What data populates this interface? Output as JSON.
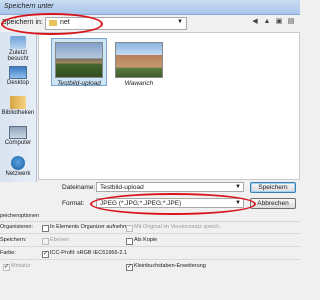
{
  "window": {
    "title": "Speichern unter"
  },
  "toolbar": {
    "lookin_label": "Speichern in:",
    "lookin_value": "net"
  },
  "places": [
    {
      "label": "Zuletzt besucht",
      "icon": "recent-places-icon"
    },
    {
      "label": "Desktop",
      "icon": "desktop-icon"
    },
    {
      "label": "Bibliotheken",
      "icon": "libraries-icon"
    },
    {
      "label": "Computer",
      "icon": "computer-icon"
    },
    {
      "label": "Netzwerk",
      "icon": "network-icon"
    }
  ],
  "files": [
    {
      "name": "Testbild-upload",
      "selected": true
    },
    {
      "name": "Wawarich",
      "selected": false
    }
  ],
  "form": {
    "filename_label": "Dateiname:",
    "filename_value": "Testbild-upload",
    "format_label": "Format:",
    "format_value": "JPEG (*.JPG;*.JPEG;*.JPE)",
    "save_label": "Speichern",
    "cancel_label": "Abbrechen"
  },
  "options": {
    "heading": "peicheroptionen",
    "organize_label": "Organisieren:",
    "organizer_checkbox": "In Elements Organizer aufnehm.",
    "original_checkbox": "Mit Original im Versionssatz speich.",
    "save_label": "Speichern:",
    "layers_checkbox": "Ebenen",
    "copy_checkbox": "Als Kopie",
    "color_label": "Farbe:",
    "icc_checkbox": "ICC-Profil: sRGB IEC61966-2.1",
    "thumbnail_checkbox": "Miniatur",
    "lowercase_checkbox": "Kleinbuchstaben-Erweiterung"
  },
  "colors": {
    "annotation": "#d8141a",
    "accent": "#3c7fb1",
    "selection": "#cde6f7"
  }
}
